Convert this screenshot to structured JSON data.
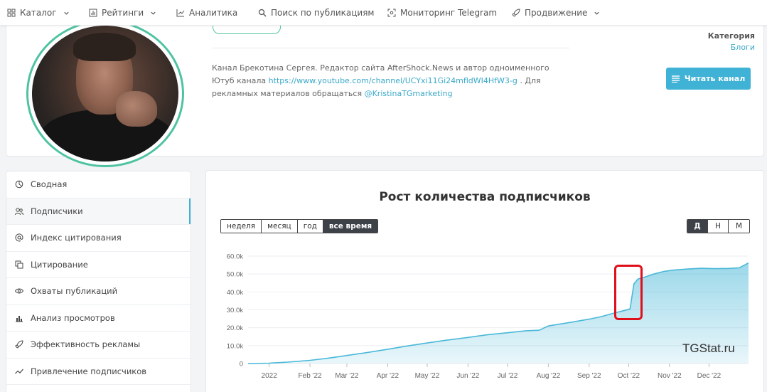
{
  "nav": {
    "items": [
      {
        "label": "Каталог",
        "icon": "grid-icon",
        "dropdown": true
      },
      {
        "label": "Рейтинги",
        "icon": "ratings-icon",
        "dropdown": true
      },
      {
        "label": "Аналитика",
        "icon": "analytics-icon",
        "dropdown": false
      },
      {
        "label": "Поиск по публикациям",
        "icon": "search-icon",
        "dropdown": false
      },
      {
        "label": "Мониторинг Telegram",
        "icon": "monitor-icon",
        "dropdown": false
      },
      {
        "label": "Продвижение",
        "icon": "rocket-icon",
        "dropdown": true
      }
    ]
  },
  "channel": {
    "description_pre": "Канал Брекотина Сергея. Редактор сайта AfterShock.News и автор одноименного Ютуб канала ",
    "link_youtube": "https://www.youtube.com/channel/UCYxi11Gi24mfldWI4HfW3-g",
    "description_mid": " . Для рекламных материалов обращаться ",
    "link_contact": "@KristinaTGmarketing",
    "category_label": "Категория",
    "category_value": "Блоги",
    "read_button": "Читать канал"
  },
  "sidebar": {
    "items": [
      {
        "label": "Сводная",
        "icon": "summary-icon",
        "active": false
      },
      {
        "label": "Подписчики",
        "icon": "subscribers-icon",
        "active": true
      },
      {
        "label": "Индекс цитирования",
        "icon": "at-icon",
        "active": false
      },
      {
        "label": "Цитирование",
        "icon": "quote-icon",
        "active": false
      },
      {
        "label": "Охваты публикаций",
        "icon": "eye-icon",
        "active": false
      },
      {
        "label": "Анализ просмотров",
        "icon": "bar-chart-icon",
        "active": false
      },
      {
        "label": "Эффективность рекламы",
        "icon": "megaphone-icon",
        "active": false
      },
      {
        "label": "Привлечение подписчиков",
        "icon": "trend-icon",
        "active": false
      }
    ]
  },
  "chart_panel": {
    "title": "Рост количества подписчиков",
    "ranges": [
      {
        "label": "неделя",
        "active": false
      },
      {
        "label": "месяц",
        "active": false
      },
      {
        "label": "год",
        "active": false
      },
      {
        "label": "все время",
        "active": true
      }
    ],
    "granularity": [
      {
        "label": "Д",
        "active": true
      },
      {
        "label": "Н",
        "active": false
      },
      {
        "label": "М",
        "active": false
      }
    ],
    "watermark": "TGStat.ru"
  },
  "chart_data": {
    "type": "area",
    "title": "Рост количества подписчиков",
    "xlabel": "",
    "ylabel": "",
    "ylim": [
      0,
      60000
    ],
    "y_ticks": [
      "0",
      "10.0k",
      "20.0k",
      "30.0k",
      "40.0k",
      "50.0k",
      "60.0k"
    ],
    "x_ticks": [
      "2022",
      "Feb '22",
      "Mar '22",
      "Apr '22",
      "May '22",
      "Jun '22",
      "Jul '22",
      "Aug '22",
      "Sep '22",
      "Oct '22",
      "Nov '22",
      "Dec '22"
    ],
    "x_tick_dates": [
      "2022-01-01",
      "2022-02-01",
      "2022-03-01",
      "2022-04-01",
      "2022-05-01",
      "2022-06-01",
      "2022-07-01",
      "2022-08-01",
      "2022-09-01",
      "2022-10-01",
      "2022-11-01",
      "2022-12-01"
    ],
    "x_range": [
      "2021-12-16",
      "2022-12-31"
    ],
    "grid": true,
    "color": "#4ab8d8",
    "series": [
      {
        "points": [
          [
            "2021-12-16",
            0
          ],
          [
            "2022-01-01",
            200
          ],
          [
            "2022-01-15",
            800
          ],
          [
            "2022-02-01",
            1800
          ],
          [
            "2022-02-15",
            3000
          ],
          [
            "2022-03-01",
            4500
          ],
          [
            "2022-03-15",
            6000
          ],
          [
            "2022-04-01",
            8000
          ],
          [
            "2022-04-15",
            9700
          ],
          [
            "2022-05-01",
            11500
          ],
          [
            "2022-05-15",
            13000
          ],
          [
            "2022-06-01",
            14600
          ],
          [
            "2022-06-15",
            16000
          ],
          [
            "2022-07-01",
            17200
          ],
          [
            "2022-07-15",
            18300
          ],
          [
            "2022-07-25",
            18600
          ],
          [
            "2022-08-01",
            21000
          ],
          [
            "2022-08-10",
            22100
          ],
          [
            "2022-08-20",
            23300
          ],
          [
            "2022-09-01",
            24800
          ],
          [
            "2022-09-10",
            26200
          ],
          [
            "2022-09-20",
            28200
          ],
          [
            "2022-09-28",
            29700
          ],
          [
            "2022-10-02",
            30500
          ],
          [
            "2022-10-05",
            44500
          ],
          [
            "2022-10-08",
            47200
          ],
          [
            "2022-10-12",
            48000
          ],
          [
            "2022-10-20",
            50000
          ],
          [
            "2022-10-28",
            51500
          ],
          [
            "2022-11-05",
            52300
          ],
          [
            "2022-11-15",
            52800
          ],
          [
            "2022-11-25",
            53200
          ],
          [
            "2022-12-05",
            53000
          ],
          [
            "2022-12-15",
            53100
          ],
          [
            "2022-12-24",
            53500
          ],
          [
            "2022-12-31",
            56200
          ]
        ]
      }
    ],
    "annotations": [
      {
        "type": "highlight-box",
        "color": "#e0101a",
        "from": "2022-09-28",
        "to": "2022-10-10"
      }
    ]
  }
}
